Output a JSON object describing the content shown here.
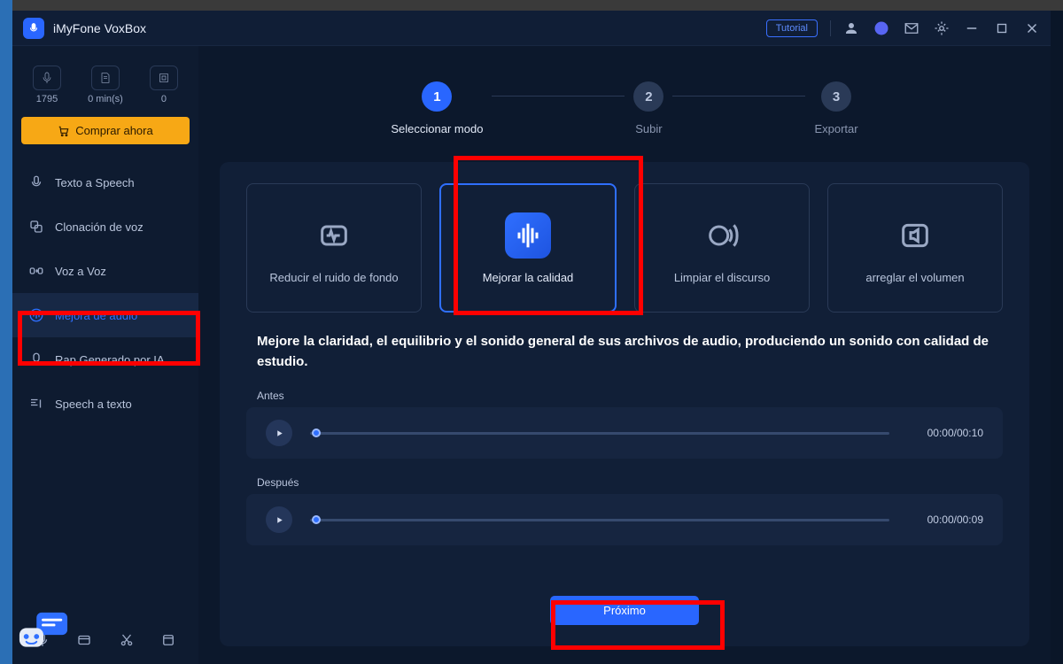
{
  "app": {
    "title": "iMyFone VoxBox"
  },
  "titlebar": {
    "tutorial": "Tutorial"
  },
  "stats": {
    "mic_value": "1795",
    "time_value": "0 min(s)",
    "export_value": "0"
  },
  "buy": {
    "label": "Comprar ahora"
  },
  "nav": {
    "tts": "Texto a Speech",
    "clone": "Clonación de voz",
    "v2v": "Voz a Voz",
    "enhance": "Mejora de audio",
    "rap": "Rap Generado por IA",
    "stt": "Speech a texto"
  },
  "stepper": {
    "s1_num": "1",
    "s1_label": "Seleccionar modo",
    "s2_num": "2",
    "s2_label": "Subir",
    "s3_num": "3",
    "s3_label": "Exportar"
  },
  "modes": {
    "reduce": "Reducir el ruido de fondo",
    "improve": "Mejorar la calidad",
    "clean": "Limpiar el discurso",
    "volume": "arreglar el volumen"
  },
  "description": "Mejore la claridad, el equilibrio y el sonido general de sus archivos de audio, produciendo un sonido con calidad de estudio.",
  "player": {
    "before_label": "Antes",
    "before_time": "00:00/00:10",
    "after_label": "Después",
    "after_time": "00:00/00:09"
  },
  "next": {
    "label": "Próximo"
  }
}
